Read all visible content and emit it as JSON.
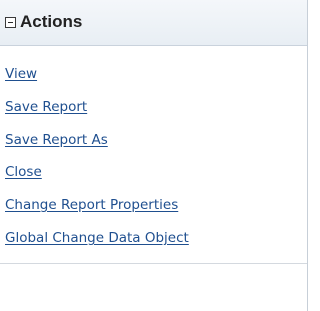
{
  "panel": {
    "title": "Actions",
    "toggle_icon": "collapse-minus-icon"
  },
  "actions": [
    {
      "label": "View"
    },
    {
      "label": "Save Report"
    },
    {
      "label": "Save Report As"
    },
    {
      "label": "Close"
    },
    {
      "label": "Change Report Properties"
    },
    {
      "label": "Global Change Data Object"
    }
  ],
  "colors": {
    "link": "#1f4f8f",
    "header_bg": "#eaf0f5",
    "title": "#222222"
  }
}
